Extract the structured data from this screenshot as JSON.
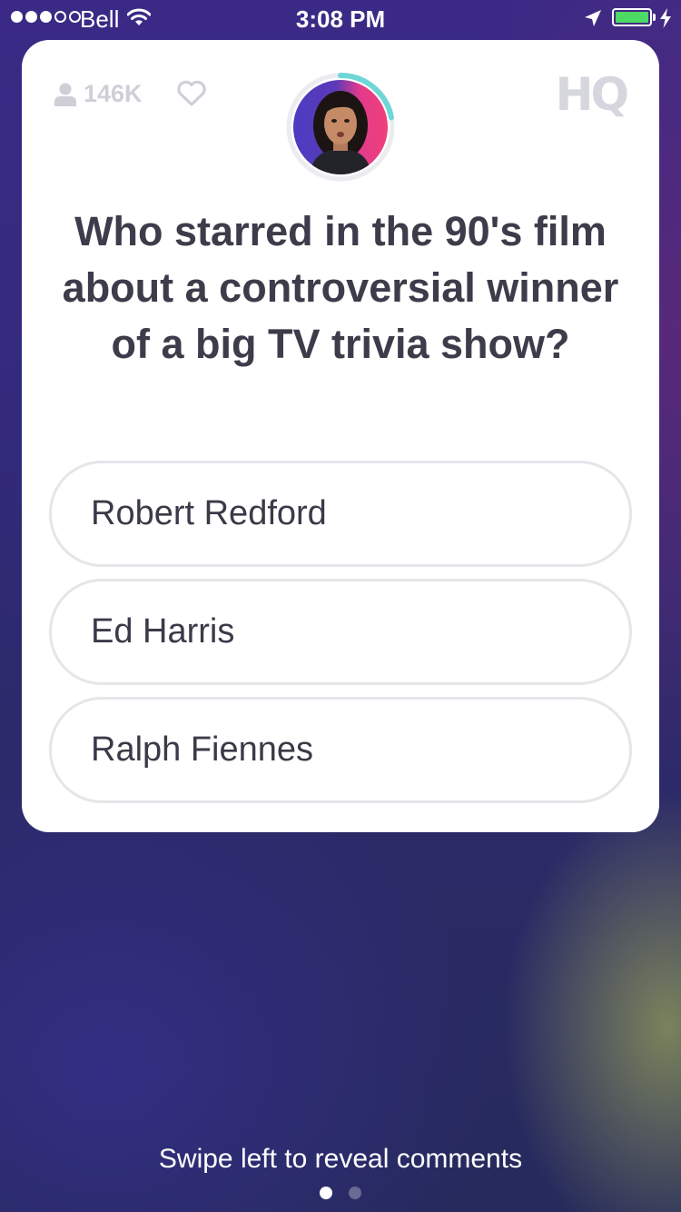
{
  "status_bar": {
    "carrier": "Bell",
    "time": "3:08 PM",
    "signal_bars_filled": 3,
    "signal_bars_total": 5,
    "battery_level": 1.0,
    "charging": true,
    "battery_color": "#4cd964"
  },
  "game": {
    "viewer_count": "146K",
    "logo_text": "HQ",
    "timer_color": "#6fd6d6",
    "timer_fraction_remaining": 0.22,
    "question": "Who starred in the 90's film about a controversial winner of a big TV trivia show?",
    "answers": [
      {
        "label": "Robert Redford"
      },
      {
        "label": "Ed Harris"
      },
      {
        "label": "Ralph Fiennes"
      }
    ]
  },
  "footer": {
    "hint": "Swipe left to reveal comments",
    "page_count": 2,
    "active_page": 1
  },
  "icons": {
    "viewers": "person-icon",
    "like": "heart-icon",
    "location": "location-arrow-icon",
    "wifi": "wifi-icon",
    "charging": "lightning-bolt-icon"
  }
}
